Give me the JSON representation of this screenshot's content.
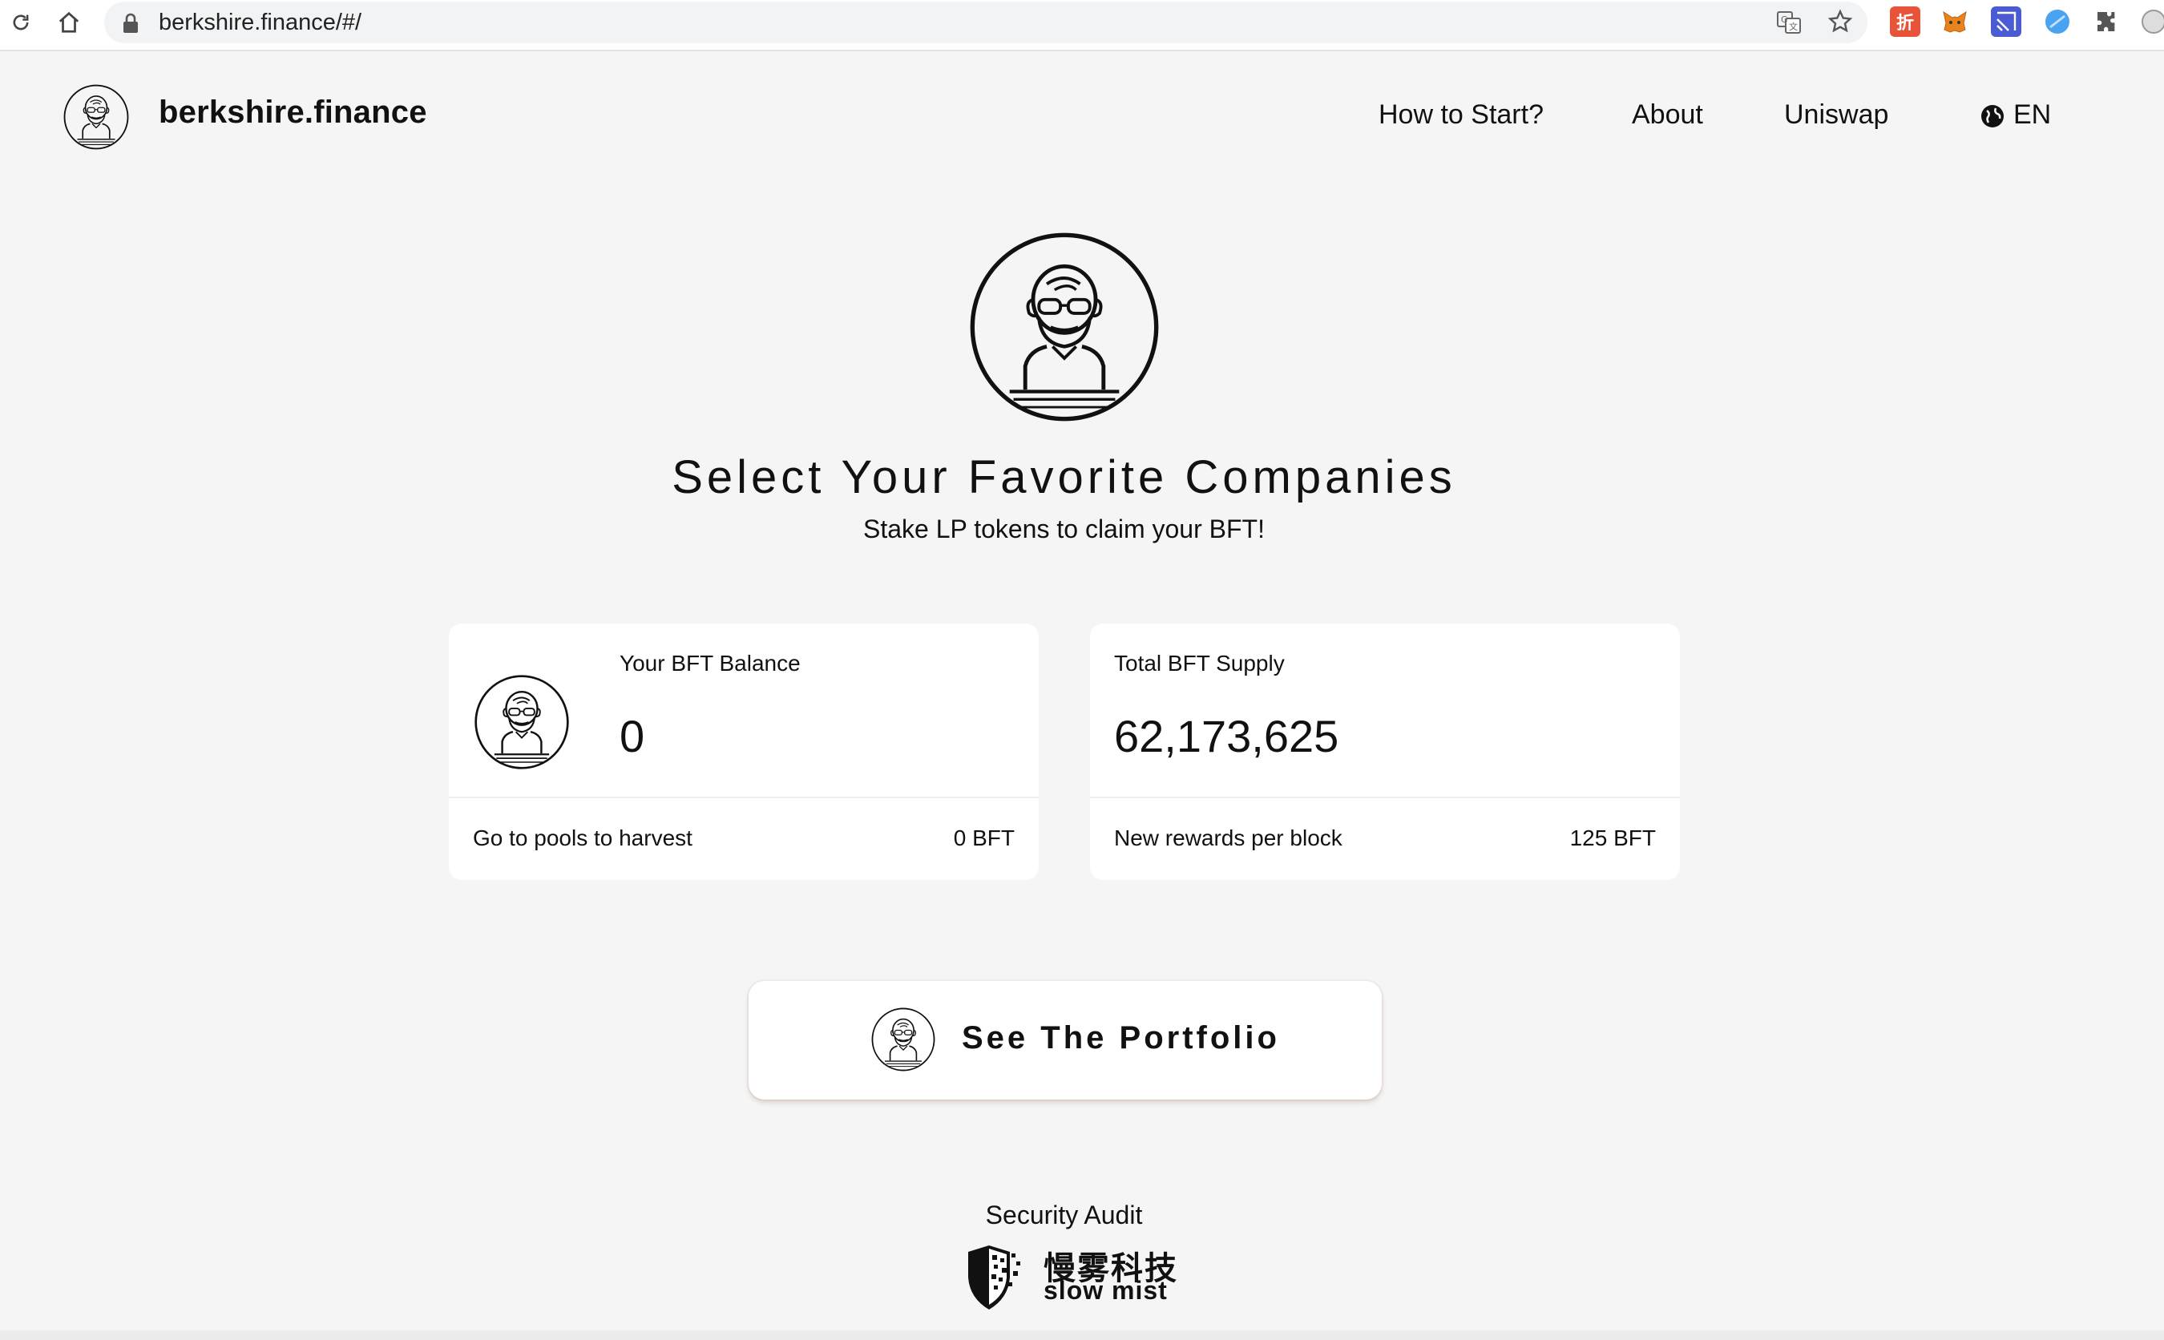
{
  "browser": {
    "url": "berkshire.finance/#/",
    "extensions": [
      {
        "name": "translate-icon"
      },
      {
        "name": "bookmark-star-icon"
      },
      {
        "name": "discount-extension-icon",
        "label": "折",
        "color": "#e8543a"
      },
      {
        "name": "metamask-fox-icon",
        "color": "#e8831d"
      },
      {
        "name": "vpn-extension-icon",
        "color": "#4a5bd4"
      },
      {
        "name": "blue-circle-extension-icon",
        "color": "#4aa3f0"
      },
      {
        "name": "puzzle-extensions-icon"
      }
    ]
  },
  "header": {
    "site_name": "berkshire.finance",
    "nav": [
      {
        "label": "How to Start?"
      },
      {
        "label": "About"
      },
      {
        "label": "Uniswap"
      }
    ],
    "language": "EN"
  },
  "hero": {
    "title": "Select Your Favorite Companies",
    "subtitle": "Stake LP tokens to claim your BFT!"
  },
  "cards": [
    {
      "label": "Your BFT Balance",
      "value": "0",
      "footer_label": "Go to pools to harvest",
      "footer_value": "0 BFT"
    },
    {
      "label": "Total BFT Supply",
      "value": "62,173,625",
      "footer_label": "New rewards per block",
      "footer_value": "125 BFT"
    }
  ],
  "portfolio_button": {
    "label": "See The Portfolio"
  },
  "footer": {
    "audit_label": "Security Audit",
    "auditor_cn": "慢雾科技",
    "auditor_en": "slow mist"
  },
  "colors": {
    "page_background": "#f5f5f5",
    "card_background": "#ffffff",
    "text": "#111111"
  }
}
